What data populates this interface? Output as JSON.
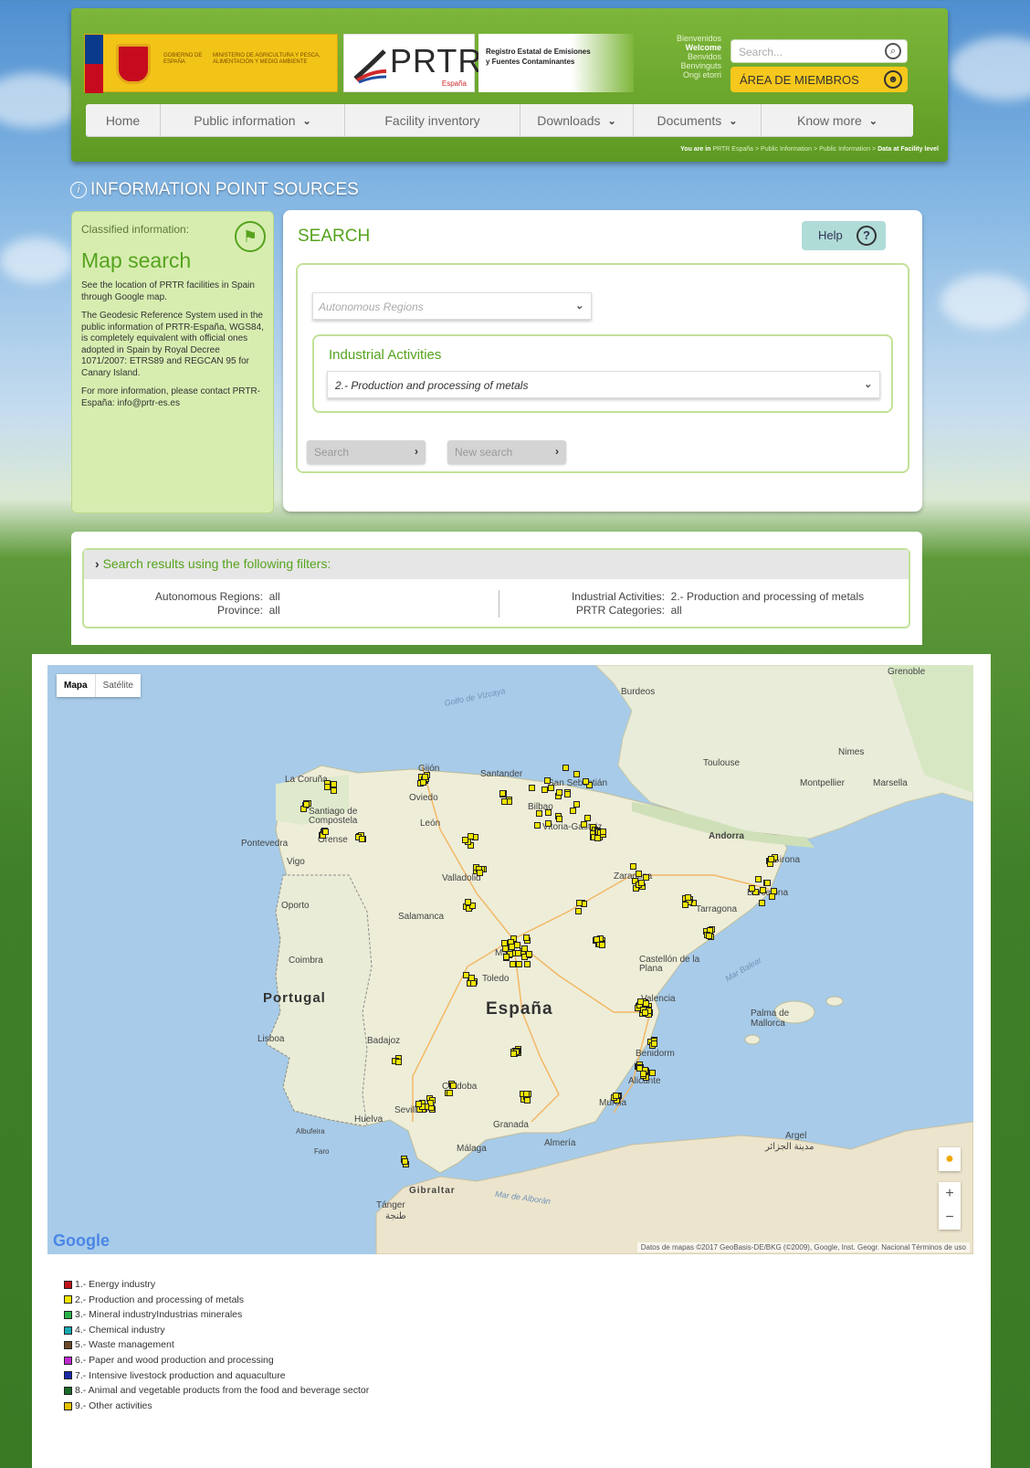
{
  "header": {
    "gov_line1": "GOBIERNO DE ESPAÑA",
    "gov_line2": "MINISTERIO DE AGRICULTURA Y PESCA, ALIMENTACIÓN Y MEDIO AMBIENTE",
    "logo_text": "PRTR",
    "logo_sub": "España",
    "registry": "Registro Estatal de Emisiones y Fuentes Contaminantes",
    "languages": [
      "Bienvenidos",
      "Welcome",
      "Benvidos",
      "Benvinguts",
      "Ongi etorri"
    ],
    "active_language": "Welcome",
    "search_placeholder": "Search...",
    "members_label": "ÁREA DE MIEMBROS"
  },
  "nav": [
    {
      "label": "Home",
      "dropdown": false
    },
    {
      "label": "Public information",
      "dropdown": true
    },
    {
      "label": "Facility inventory",
      "dropdown": false
    },
    {
      "label": "Downloads",
      "dropdown": true
    },
    {
      "label": "Documents",
      "dropdown": true
    },
    {
      "label": "Know more",
      "dropdown": true
    }
  ],
  "breadcrumb": {
    "prefix": "You are in",
    "items": [
      "PRTR España",
      "Public Information",
      "Public Information"
    ],
    "current": "Data at Facility level"
  },
  "page_title": "INFORMATION POINT SOURCES",
  "left_panel": {
    "classified": "Classified information:",
    "heading": "Map search",
    "p1": "See the location of PRTR facilities in Spain through Google map.",
    "p2": "The Geodesic Reference System used in the public information of PRTR-España, WGS84, is completely equivalent with official ones adopted in Spain by Royal Decree 1071/2007: ETRS89 and REGCAN 95 for Canary Island.",
    "p3": "For more information, please contact PRTR-España: info@prtr-es.es"
  },
  "search": {
    "title": "SEARCH",
    "help": "Help",
    "regions_placeholder": "Autonomous Regions",
    "activities_label": "Industrial Activities",
    "activities_value": "2.- Production and processing of metals",
    "search_btn": "Search",
    "new_search_btn": "New search"
  },
  "results": {
    "heading": "Search results using the following filters:",
    "filters": [
      {
        "key": "Autonomous Regions:",
        "value": "all"
      },
      {
        "key": "Province:",
        "value": "all"
      },
      {
        "key": "Industrial Activities:",
        "value": "2.- Production and processing of metals"
      },
      {
        "key": "PRTR Categories:",
        "value": "all"
      }
    ]
  },
  "map": {
    "type_map": "Mapa",
    "type_sat": "Satélite",
    "country_labels": [
      "España",
      "Portugal"
    ],
    "city_labels": [
      "Burdeos",
      "Toulouse",
      "Nimes",
      "Montpellier",
      "Marsella",
      "Grenoble",
      "Andorra",
      "Gijón",
      "Santander",
      "San Sebastián",
      "Bilbao",
      "Oviedo",
      "La Coruña",
      "Santiago de Compostela",
      "Pontevedra",
      "Vigo",
      "Orense",
      "León",
      "Vitoria-Gasteiz",
      "Valladolid",
      "Zaragoza",
      "Girona",
      "Barcelona",
      "Tarragona",
      "Salamanca",
      "Oporto",
      "Coimbra",
      "Madrid",
      "Toledo",
      "Castellón de la Plana",
      "Valencia",
      "Palma de Mallorca",
      "Lisboa",
      "Badajoz",
      "Benidorm",
      "Alicante",
      "Murcia",
      "Córdoba",
      "Sevilla",
      "Huelva",
      "Granada",
      "Almería",
      "Málaga",
      "Albufeira",
      "Faro",
      "Gibraltar",
      "Tánger",
      "طنجة",
      "Argel",
      "مدينة الجزائر"
    ],
    "sea_labels": [
      "Golfo de Vizcaya",
      "Mar Balear",
      "Mar de Alborán"
    ],
    "attribution": "Datos de mapas ©2017 GeoBasis-DE/BKG (©2009), Google, Inst. Geogr. Nacional    Términos de uso",
    "google": "Google",
    "marker_color": "#f2e600"
  },
  "legend": [
    {
      "label": "1.- Energy industry",
      "color": "#c0141a"
    },
    {
      "label": "2.- Production and processing of metals",
      "color": "#f2e600"
    },
    {
      "label": "3.- Mineral industryIndustrias minerales",
      "color": "#2bb34a"
    },
    {
      "label": "4.- Chemical industry",
      "color": "#1aa9b0"
    },
    {
      "label": "5.- Waste management",
      "color": "#6b4a2a"
    },
    {
      "label": "6.- Paper and wood production and processing",
      "color": "#c02ad0"
    },
    {
      "label": "7.- Intensive livestock production and aquaculture",
      "color": "#1a2aa8"
    },
    {
      "label": "8.- Animal and vegetable products from the food and beverage sector",
      "color": "#1a6a2a"
    },
    {
      "label": "9.- Other activities",
      "color": "#e6c200"
    }
  ]
}
